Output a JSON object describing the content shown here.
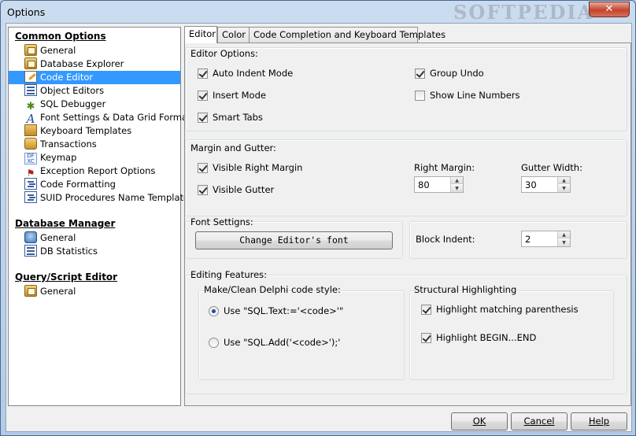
{
  "window": {
    "title": "Options",
    "watermark": "SOFTPEDIA",
    "close_glyph": "✕"
  },
  "tree": {
    "sections": [
      {
        "title": "Common Options",
        "items": [
          {
            "label": "General",
            "icon": "config-icon"
          },
          {
            "label": "Database Explorer",
            "icon": "config-icon"
          },
          {
            "label": "Code Editor",
            "icon": "editor-icon",
            "selected": true
          },
          {
            "label": "Object Editors",
            "icon": "object-editor-icon"
          },
          {
            "label": "SQL Debugger",
            "icon": "bug-icon"
          },
          {
            "label": "Font Settings & Data Grid Formatting",
            "icon": "font-icon"
          },
          {
            "label": "Keyboard Templates",
            "icon": "template-icon"
          },
          {
            "label": "Transactions",
            "icon": "transaction-icon"
          },
          {
            "label": "Keymap",
            "icon": "keymap-icon"
          },
          {
            "label": "Exception Report Options",
            "icon": "exception-icon"
          },
          {
            "label": "Code Formatting",
            "icon": "format-icon"
          },
          {
            "label": "SUID Procedures Name Templates",
            "icon": "format-icon"
          }
        ]
      },
      {
        "title": "Database Manager",
        "items": [
          {
            "label": "General",
            "icon": "database-icon"
          },
          {
            "label": "DB Statistics",
            "icon": "statistics-icon"
          }
        ]
      },
      {
        "title": "Query/Script Editor",
        "items": [
          {
            "label": "General",
            "icon": "config-icon"
          }
        ]
      }
    ]
  },
  "tabs": [
    "Editor",
    "Color",
    "Code Completion and Keyboard Templates"
  ],
  "editor_options": {
    "title": "Editor Options:",
    "auto_indent": "Auto Indent Mode",
    "insert_mode": "Insert Mode",
    "smart_tabs": "Smart Tabs",
    "group_undo": "Group Undo",
    "show_line_numbers": "Show Line Numbers"
  },
  "margin": {
    "title": "Margin and Gutter:",
    "visible_right_margin": "Visible Right Margin",
    "visible_gutter": "Visible Gutter",
    "right_margin_label": "Right Margin:",
    "right_margin_value": "80",
    "gutter_width_label": "Gutter Width:",
    "gutter_width_value": "30"
  },
  "font": {
    "title": "Font Settigns:",
    "button": "Change Editor's font",
    "block_indent_label": "Block Indent:",
    "block_indent_value": "2"
  },
  "editing": {
    "title": "Editing Features:",
    "style_title": "Make/Clean Delphi code style:",
    "radio_text": "Use \"SQL.Text:='<code>'\"",
    "radio_add": "Use \"SQL.Add('<code>');'",
    "structural_title": "Structural Highlighting",
    "highlight_paren": "Highlight matching parenthesis",
    "highlight_begin": "Highlight BEGIN...END"
  },
  "buttons": {
    "ok": "OK",
    "cancel": "Cancel",
    "help": "Help"
  }
}
